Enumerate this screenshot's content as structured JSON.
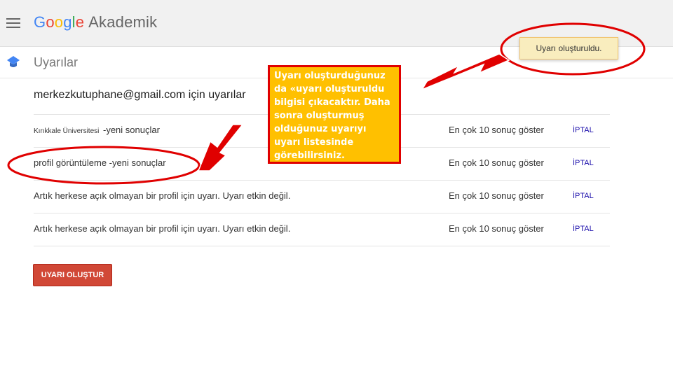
{
  "header": {
    "logo_letters": [
      "G",
      "o",
      "o",
      "g",
      "l",
      "e"
    ],
    "product": "Akademik"
  },
  "subbar": {
    "title": "Uyarılar"
  },
  "section": {
    "heading": "merkezkutuphane@gmail.com için uyarılar"
  },
  "alerts": [
    {
      "institution": "Kırıkkale Üniversitesi",
      "query": "-yeni sonuçlar",
      "count": "En çok 10 sonuç göster",
      "cancel": "İPTAL"
    },
    {
      "institution": "",
      "query": "profil görüntüleme -yeni sonuçlar",
      "count": "En çok 10 sonuç göster",
      "cancel": "İPTAL"
    },
    {
      "institution": "",
      "query": "Artık herkese açık olmayan bir profil için uyarı. Uyarı etkin değil.",
      "count": "En çok 10 sonuç göster",
      "cancel": "İPTAL"
    },
    {
      "institution": "",
      "query": "Artık herkese açık olmayan bir profil için uyarı. Uyarı etkin değil.",
      "count": "En çok 10 sonuç göster",
      "cancel": "İPTAL"
    }
  ],
  "create_button": "UYARI OLUŞTUR",
  "toast": "Uyarı oluşturuldu.",
  "callout": "Uyarı oluşturduğunuz da «uyarı oluşturuldu bilgisi çıkacaktır. Daha sonra oluşturmuş olduğunuz uyarıyı uyarı listesinde görebilirsiniz.",
  "colors": {
    "create_button": "#d14836",
    "toast_bg": "#f9edbe",
    "callout_bg": "#ffc000",
    "annotation_red": "#e00000",
    "cancel_link": "#1a0dab"
  },
  "icons": [
    "menu-icon",
    "alert-logo-icon"
  ]
}
